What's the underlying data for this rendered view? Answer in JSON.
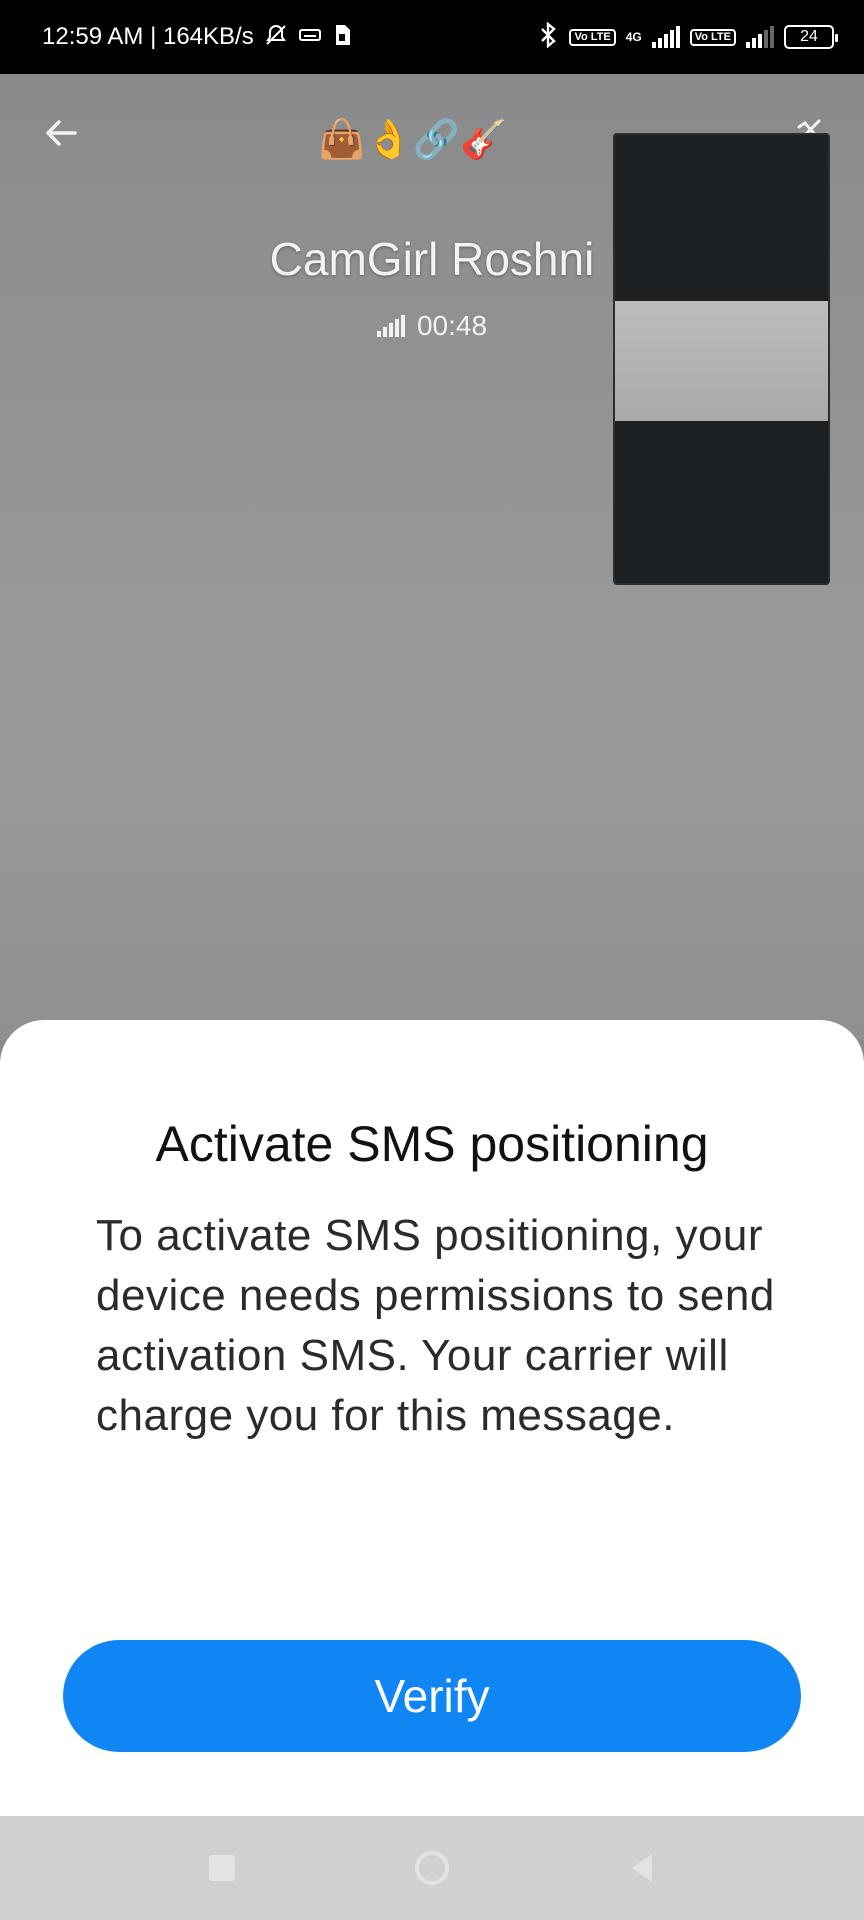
{
  "status_bar": {
    "time_and_speed": "12:59 AM | 164KB/s",
    "mute_icon": "bell-off-icon",
    "keyboard_icon": "keyboard-icon",
    "sim_icon": "sim-card-icon",
    "bluetooth_icon": "bluetooth-icon",
    "volte_label_1": "Vo LTE",
    "network_label": "4G",
    "volte_label_2": "Vo LTE",
    "battery_level": "24"
  },
  "call": {
    "back_icon": "arrow-left-icon",
    "emoji_strip": "👜👌🔗🎸",
    "caller_name": "CamGirl Roshni",
    "duration": "00:48",
    "signal_icon": "signal-bars-icon",
    "pip_toggle_icon": "camera-switch-icon"
  },
  "sheet": {
    "title": "Activate SMS positioning",
    "body": "To activate SMS positioning, your device needs permissions to send activation SMS. Your carrier will charge you for this message.",
    "verify_label": "Verify"
  },
  "nav_bar": {
    "recents_icon": "square-icon",
    "home_icon": "circle-icon",
    "back_icon": "triangle-back-icon"
  },
  "colors": {
    "accent": "#1086f5",
    "sheet_background": "#fffffe",
    "status_bar": "#000000",
    "nav_bar": "#cfd0cf"
  }
}
